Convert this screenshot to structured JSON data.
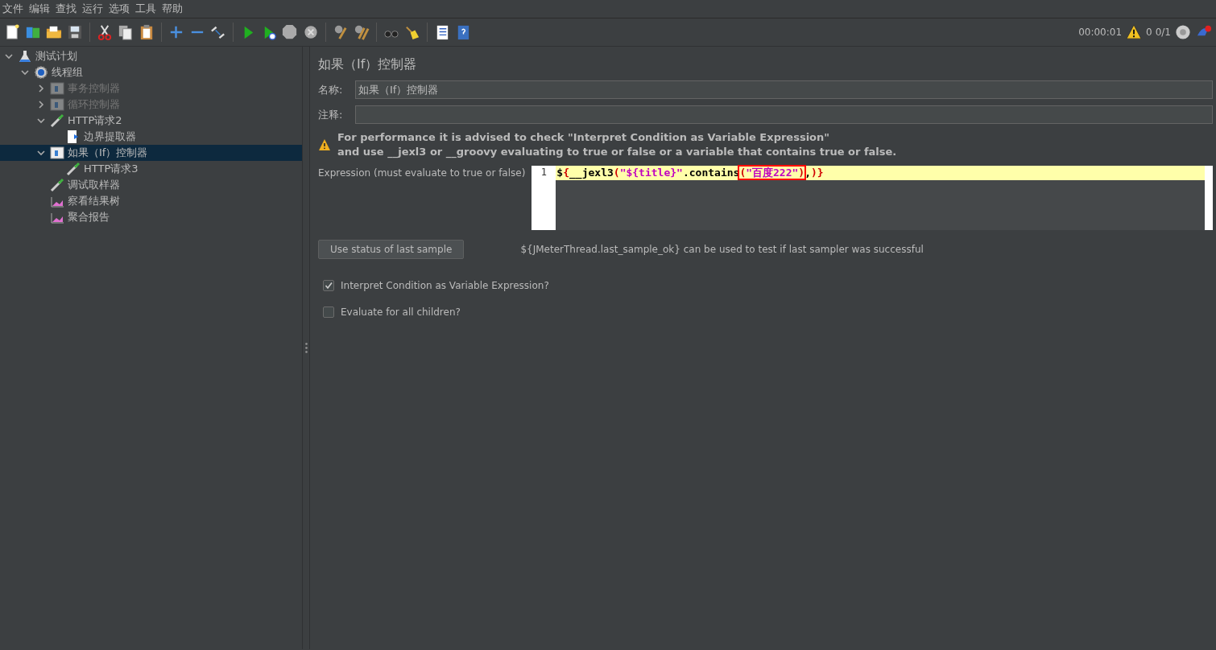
{
  "menu": [
    "文件",
    "编辑",
    "查找",
    "运行",
    "选项",
    "工具",
    "帮助"
  ],
  "toolbar_status": {
    "elapsed": "00:00:01",
    "warnings": "0",
    "threads": "0/1"
  },
  "tree": [
    {
      "label": "测试计划",
      "kind": "plan",
      "expanded": true,
      "selected": false,
      "disabled": false,
      "children": [
        {
          "label": "线程组",
          "kind": "threadgroup",
          "expanded": true,
          "selected": false,
          "disabled": false,
          "children": [
            {
              "label": "事务控制器",
              "kind": "controller",
              "expanded": false,
              "selected": false,
              "disabled": true
            },
            {
              "label": "循环控制器",
              "kind": "controller",
              "expanded": false,
              "selected": false,
              "disabled": true
            },
            {
              "label": "HTTP请求2",
              "kind": "sampler",
              "expanded": true,
              "selected": false,
              "disabled": false,
              "children": [
                {
                  "label": "边界提取器",
                  "kind": "extractor",
                  "selected": false,
                  "disabled": false
                }
              ]
            },
            {
              "label": "如果（If）控制器",
              "kind": "controller",
              "expanded": true,
              "selected": true,
              "disabled": false,
              "children": [
                {
                  "label": "HTTP请求3",
                  "kind": "sampler",
                  "selected": false,
                  "disabled": false
                }
              ]
            },
            {
              "label": "调试取样器",
              "kind": "sampler",
              "selected": false,
              "disabled": false
            },
            {
              "label": "察看结果树",
              "kind": "listener",
              "selected": false,
              "disabled": false
            },
            {
              "label": "聚合报告",
              "kind": "listener",
              "selected": false,
              "disabled": false
            }
          ]
        }
      ]
    }
  ],
  "panel": {
    "title": "如果（If）控制器",
    "name_label": "名称:",
    "name_value": "如果（If）控制器",
    "comment_label": "注释:",
    "warning_lines": [
      "For performance it is advised to check \"Interpret Condition as Variable Expression\"",
      "and use __jexl3 or __groovy evaluating to true or false or a variable that contains true or false."
    ],
    "expression_label": "Expression (must evaluate to true or false)",
    "line_number": "1",
    "expression_tokens": [
      {
        "text": "$",
        "kind": "plain",
        "boxed": false
      },
      {
        "text": "{",
        "kind": "bracket",
        "boxed": false
      },
      {
        "text": "__jexl3",
        "kind": "plain",
        "boxed": false
      },
      {
        "text": "(",
        "kind": "bracket",
        "boxed": false
      },
      {
        "text": "\"${title}\"",
        "kind": "string",
        "boxed": false
      },
      {
        "text": ".contains",
        "kind": "plain",
        "boxed": false
      },
      {
        "text": "(",
        "kind": "bracket",
        "boxed": true
      },
      {
        "text": "\"百度222\"",
        "kind": "string",
        "boxed": true
      },
      {
        "text": ")",
        "kind": "bracket",
        "boxed": true
      },
      {
        "text": ",",
        "kind": "plain",
        "boxed": false
      },
      {
        "text": ")}",
        "kind": "bracket",
        "boxed": false
      }
    ],
    "button": "Use status of last sample",
    "hint": "${JMeterThread.last_sample_ok} can be used to test if last sampler was successful",
    "checkboxes": [
      {
        "label": "Interpret Condition as Variable Expression?",
        "checked": true
      },
      {
        "label": "Evaluate for all children?",
        "checked": false
      }
    ]
  }
}
